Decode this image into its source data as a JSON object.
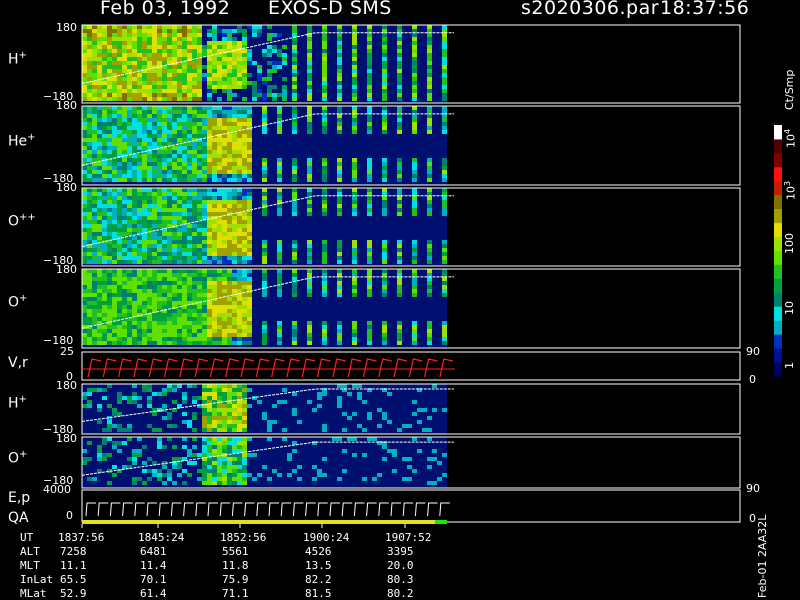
{
  "header": {
    "date": "Feb 03, 1992",
    "mission": "EXOS-D SMS",
    "file": "s2020306.par",
    "time": "18:37:56"
  },
  "colors": {
    "background": "#000000",
    "no_data": "#001070",
    "trace": "#ffffff",
    "velocity": "#ff2020",
    "qa_bar": "#e0e020",
    "qa_bar_end": "#20e020"
  },
  "colorbar": {
    "unit": "Ct/Smp",
    "labels": [
      "1",
      "10",
      "100",
      "10",
      "10",
      "10"
    ],
    "exponents": [
      "",
      "",
      "",
      "3",
      "4",
      ""
    ],
    "colors": [
      "#000060",
      "#001090",
      "#0030c0",
      "#00b0c0",
      "#00e0e0",
      "#008070",
      "#00a040",
      "#20c020",
      "#60e000",
      "#a0e000",
      "#e0e000",
      "#a0a000",
      "#807000",
      "#c02000",
      "#ff1010",
      "#800000",
      "#500000",
      "#ffffff"
    ]
  },
  "panels": [
    {
      "name": "h-plus-panel",
      "label": "H",
      "sup": "+",
      "ymax": "180",
      "ymin": "−180"
    },
    {
      "name": "he-plus-panel",
      "label": "He",
      "sup": "+",
      "ymax": "180",
      "ymin": "−180"
    },
    {
      "name": "o-plus-plus-panel",
      "label": "O",
      "sup": "++",
      "ymax": "180",
      "ymin": "−180"
    },
    {
      "name": "o-plus-panel",
      "label": "O",
      "sup": "+",
      "ymax": "180",
      "ymin": "−180"
    },
    {
      "name": "vr-panel",
      "label": "V,r",
      "sup": "",
      "ymax": "25",
      "ymin": "0",
      "rmax": "90",
      "rmin": "0"
    },
    {
      "name": "h-plus-2-panel",
      "label": "H",
      "sup": "+",
      "ymax": "180",
      "ymin": "−180"
    },
    {
      "name": "o-plus-2-panel",
      "label": "O",
      "sup": "+",
      "ymax": "180",
      "ymin": "−180"
    },
    {
      "name": "ep-panel",
      "label": "E,p",
      "label2": "QA",
      "sup": "",
      "ymax": "4000",
      "ymin": "0",
      "rmax": "90",
      "rmin": "0"
    }
  ],
  "orbit_table": {
    "rows": [
      {
        "label": "UT",
        "values": [
          "1837:56",
          "1845:24",
          "1852:56",
          "1900:24",
          "1907:52"
        ]
      },
      {
        "label": "ALT",
        "values": [
          "7258",
          "6481",
          "5561",
          "4526",
          "3395"
        ]
      },
      {
        "label": "MLT",
        "values": [
          "11.1",
          "11.4",
          "11.8",
          "13.5",
          "20.0"
        ]
      },
      {
        "label": "InLat",
        "values": [
          "65.5",
          "70.1",
          "75.9",
          "82.2",
          "80.3"
        ]
      },
      {
        "label": "MLat",
        "values": [
          "52.9",
          "61.4",
          "71.1",
          "81.5",
          "80.2"
        ]
      }
    ]
  },
  "footer_id": "Feb-01 2AA32L",
  "chart_data": {
    "type": "heatmap",
    "title": "Feb 03, 1992   EXOS-D SMS",
    "x_ticks": [
      "1837:56",
      "1845:24",
      "1852:56",
      "1900:24",
      "1907:52"
    ],
    "data_end_fraction": 0.49,
    "panels": [
      "H+",
      "He+",
      "O++",
      "O+",
      "V,r",
      "H+",
      "O+",
      "E,p"
    ],
    "color_scale": "log",
    "color_range": [
      1,
      10000
    ],
    "color_unit": "Ct/Smp"
  }
}
